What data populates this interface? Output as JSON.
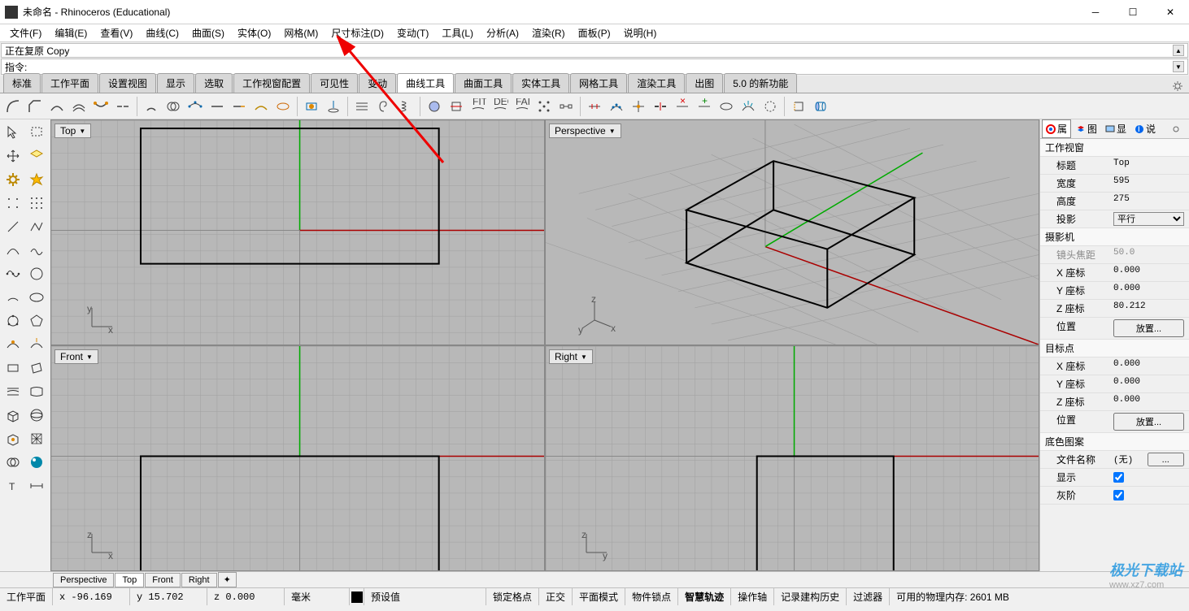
{
  "title": "未命名 - Rhinoceros (Educational)",
  "menus": [
    "文件(F)",
    "编辑(E)",
    "查看(V)",
    "曲线(C)",
    "曲面(S)",
    "实体(O)",
    "网格(M)",
    "尺寸标注(D)",
    "变动(T)",
    "工具(L)",
    "分析(A)",
    "渲染(R)",
    "面板(P)",
    "说明(H)"
  ],
  "cmd_history": "正在复原 Copy",
  "cmd_prompt": "指令:",
  "tabs": [
    "标准",
    "工作平面",
    "设置视图",
    "显示",
    "选取",
    "工作视窗配置",
    "可见性",
    "变动",
    "曲线工具",
    "曲面工具",
    "实体工具",
    "网格工具",
    "渲染工具",
    "出图",
    "5.0 的新功能"
  ],
  "tabs_active": 8,
  "viewports": {
    "tl": "Top",
    "tr": "Perspective",
    "bl": "Front",
    "br": "Right"
  },
  "bottom_tabs": [
    "Perspective",
    "Top",
    "Front",
    "Right"
  ],
  "bottom_tabs_active": 1,
  "rpanel": {
    "tabs": [
      "属",
      "图",
      "显",
      "说"
    ],
    "sections": {
      "work_window": "工作视窗",
      "title_lbl": "标题",
      "title_val": "Top",
      "width_lbl": "宽度",
      "width_val": "595",
      "height_lbl": "高度",
      "height_val": "275",
      "proj_lbl": "投影",
      "proj_val": "平行",
      "camera": "摄影机",
      "focal_lbl": "镜头焦距",
      "focal_val": "50.0",
      "cx_lbl": "X 座标",
      "cx_val": "0.000",
      "cy_lbl": "Y 座标",
      "cy_val": "0.000",
      "cz_lbl": "Z 座标",
      "cz_val": "80.212",
      "pos_lbl": "位置",
      "pos_btn": "放置...",
      "target": "目标点",
      "tx_lbl": "X 座标",
      "tx_val": "0.000",
      "ty_lbl": "Y 座标",
      "ty_val": "0.000",
      "tz_lbl": "Z 座标",
      "tz_val": "0.000",
      "tpos_lbl": "位置",
      "tpos_btn": "放置...",
      "bgpat": "底色图案",
      "fn_lbl": "文件名称",
      "fn_val": "(无)",
      "show_lbl": "显示",
      "gray_lbl": "灰阶"
    }
  },
  "status": {
    "cplane": "工作平面",
    "x": "x -96.169",
    "y": "y 15.702",
    "z": "z 0.000",
    "units": "毫米",
    "layer": "预设值",
    "snap": "锁定格点",
    "ortho": "正交",
    "planar": "平面模式",
    "osnap": "物件锁点",
    "smart": "智慧轨迹",
    "gumball": "操作轴",
    "history": "记录建构历史",
    "filter": "过滤器",
    "mem": "可用的物理内存: 2601 MB"
  },
  "watermark": {
    "text1": "极光下载站",
    "text2": "www.xz7.com"
  }
}
